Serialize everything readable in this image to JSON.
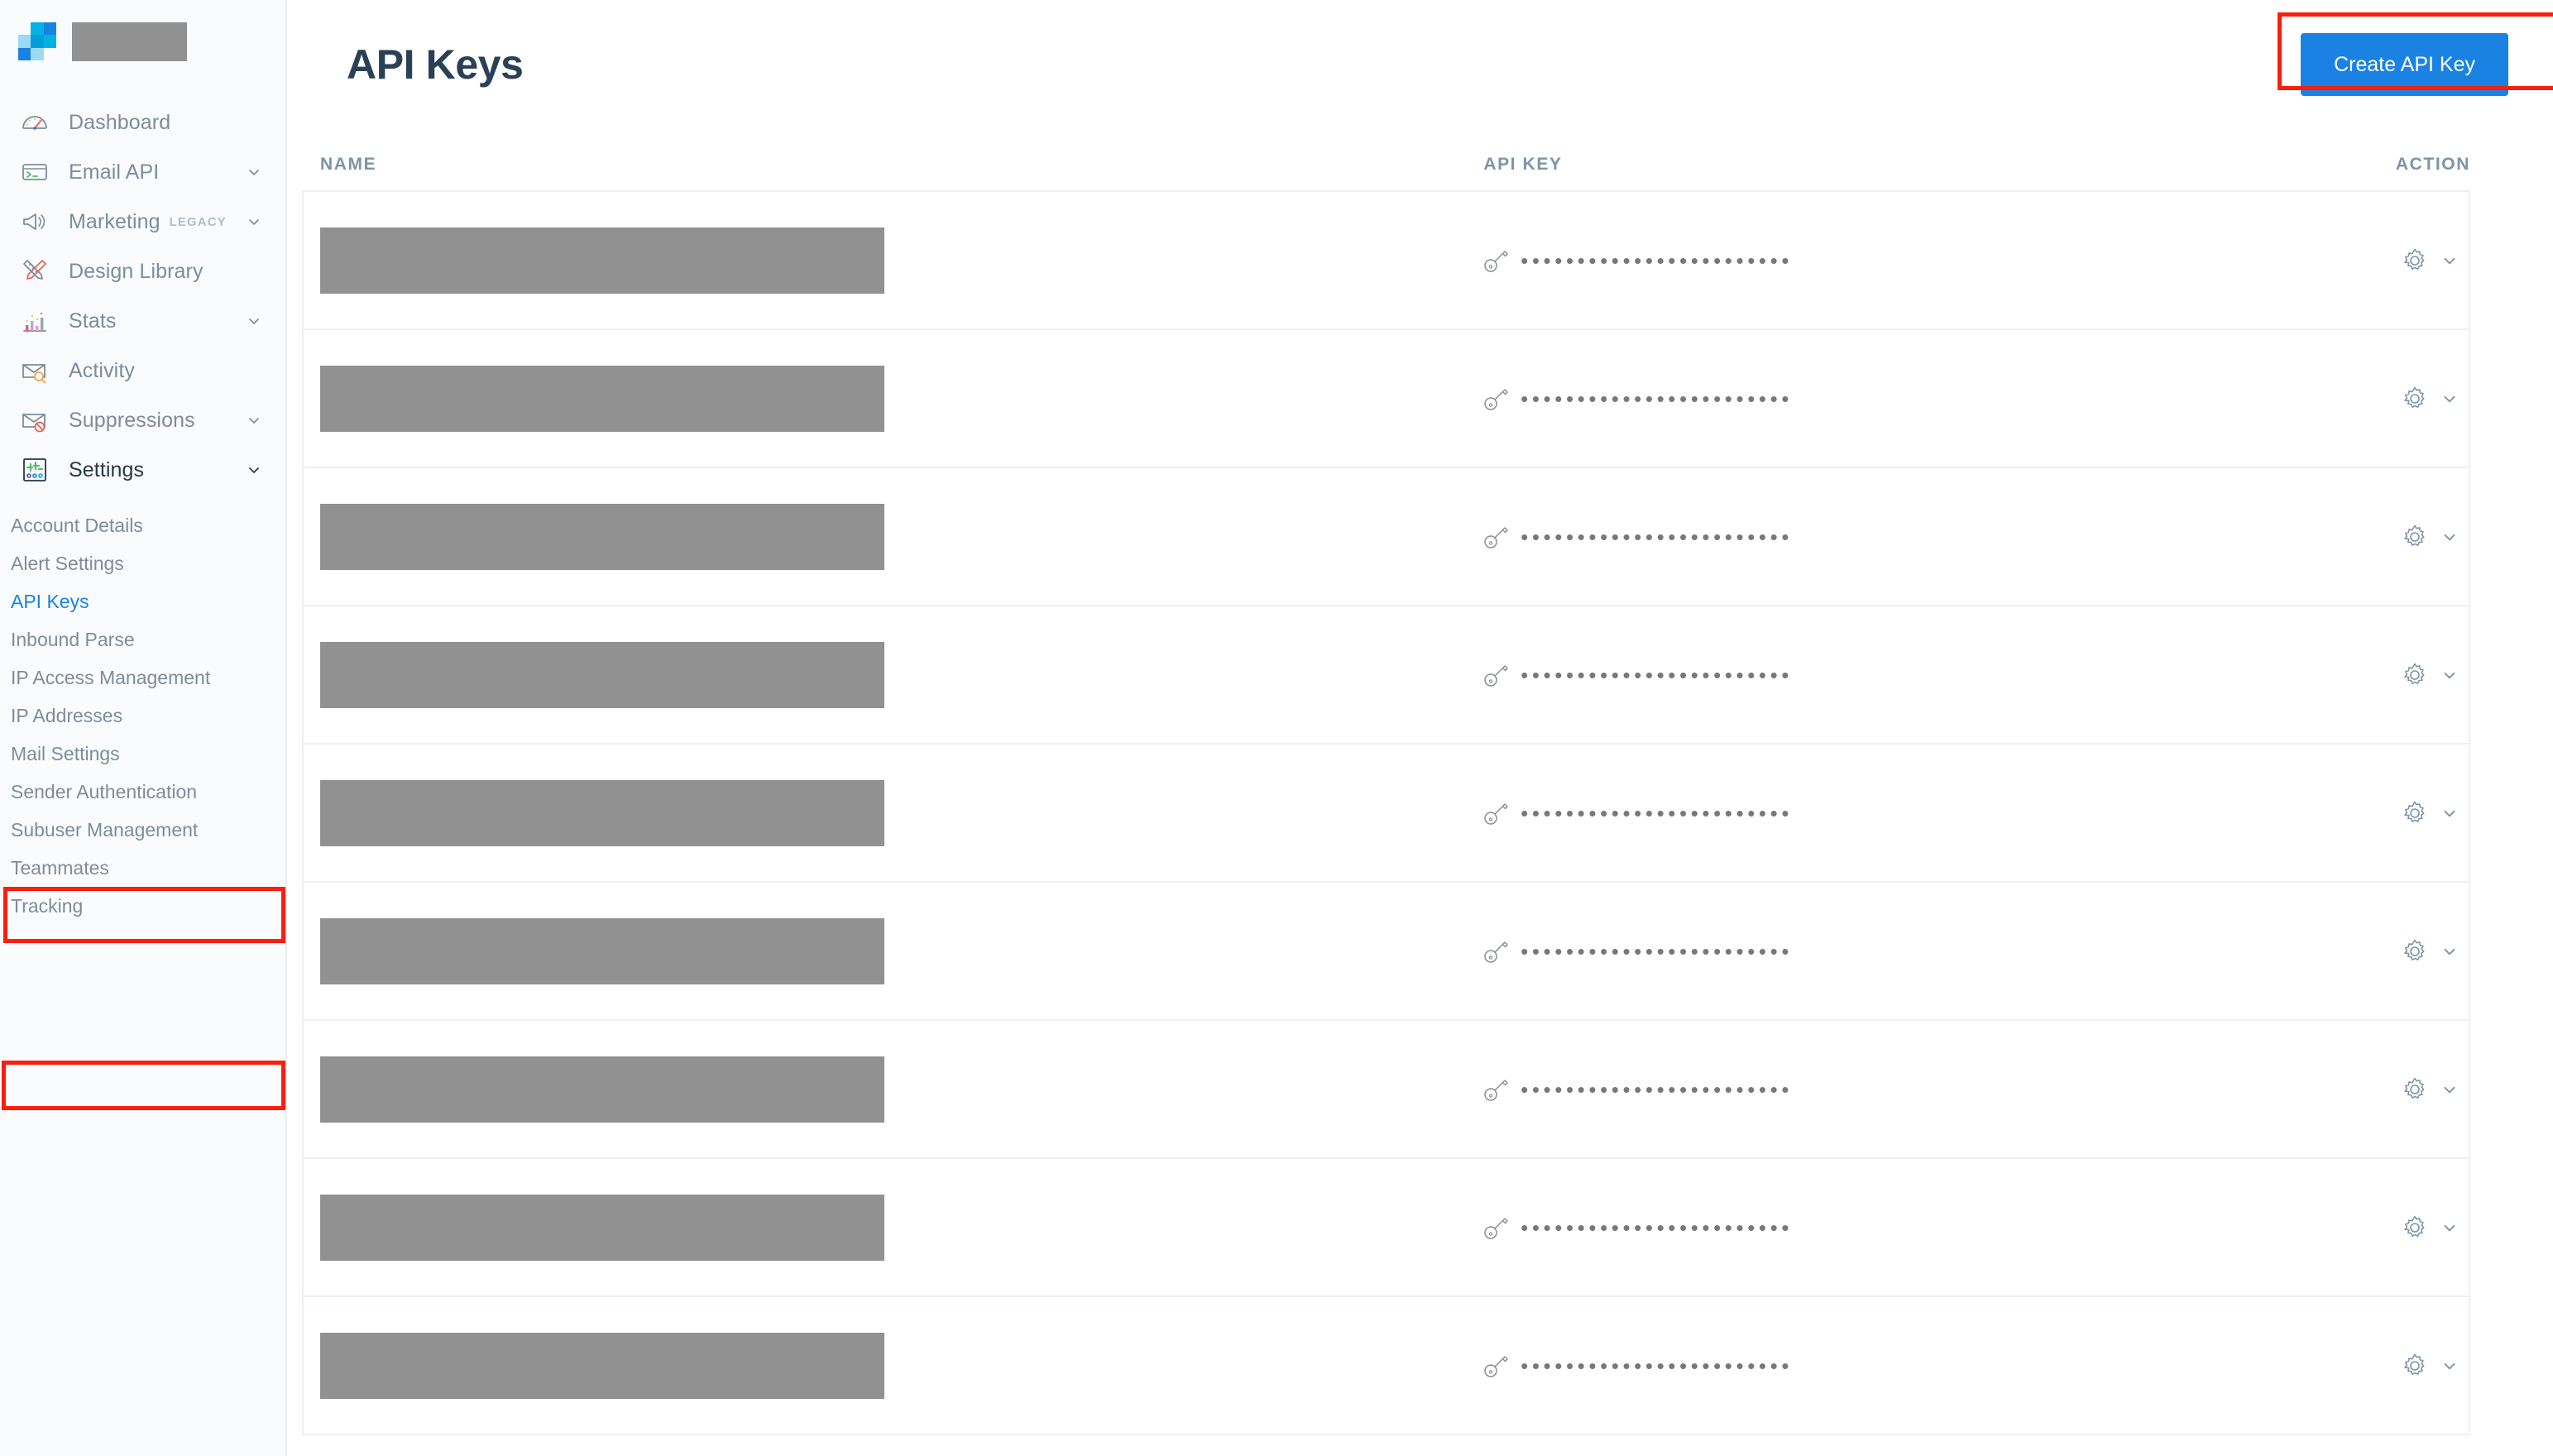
{
  "sidebar": {
    "brand": {
      "logo_icon": "sendgrid-squares-logo",
      "account_name_redacted": true
    },
    "items": [
      {
        "label": "Dashboard",
        "icon": "gauge-icon",
        "expandable": false,
        "active": false
      },
      {
        "label": "Email API",
        "icon": "terminal-icon",
        "expandable": true,
        "active": false
      },
      {
        "label": "Marketing",
        "icon": "megaphone-icon",
        "expandable": true,
        "active": false,
        "badge": "LEGACY"
      },
      {
        "label": "Design Library",
        "icon": "pencil-ruler-icon",
        "expandable": false,
        "active": false
      },
      {
        "label": "Stats",
        "icon": "bar-chart-icon",
        "expandable": true,
        "active": false
      },
      {
        "label": "Activity",
        "icon": "envelope-search-icon",
        "expandable": false,
        "active": false
      },
      {
        "label": "Suppressions",
        "icon": "envelope-block-icon",
        "expandable": true,
        "active": false
      },
      {
        "label": "Settings",
        "icon": "sliders-icon",
        "expandable": true,
        "active": true
      }
    ],
    "submenu": [
      {
        "label": "Account Details",
        "selected": false
      },
      {
        "label": "Alert Settings",
        "selected": false
      },
      {
        "label": "API Keys",
        "selected": true
      },
      {
        "label": "Inbound Parse",
        "selected": false
      },
      {
        "label": "IP Access Management",
        "selected": false
      },
      {
        "label": "IP Addresses",
        "selected": false
      },
      {
        "label": "Mail Settings",
        "selected": false
      },
      {
        "label": "Sender Authentication",
        "selected": false
      },
      {
        "label": "Subuser Management",
        "selected": false
      },
      {
        "label": "Teammates",
        "selected": false
      },
      {
        "label": "Tracking",
        "selected": false
      }
    ]
  },
  "header": {
    "title": "API Keys",
    "create_button_label": "Create API Key"
  },
  "table": {
    "columns": [
      "NAME",
      "API KEY",
      "ACTION"
    ],
    "rows": [
      {
        "name_redacted": true,
        "api_key_masked": "••••••••••••••••••••••••",
        "key_icon": "key-icon",
        "action_icon": "gear-icon",
        "action_chevron": "chevron-down-icon"
      },
      {
        "name_redacted": true,
        "api_key_masked": "••••••••••••••••••••••••",
        "key_icon": "key-icon",
        "action_icon": "gear-icon",
        "action_chevron": "chevron-down-icon"
      },
      {
        "name_redacted": true,
        "api_key_masked": "••••••••••••••••••••••••",
        "key_icon": "key-icon",
        "action_icon": "gear-icon",
        "action_chevron": "chevron-down-icon"
      },
      {
        "name_redacted": true,
        "api_key_masked": "••••••••••••••••••••••••",
        "key_icon": "key-icon",
        "action_icon": "gear-icon",
        "action_chevron": "chevron-down-icon"
      },
      {
        "name_redacted": true,
        "api_key_masked": "••••••••••••••••••••••••",
        "key_icon": "key-icon",
        "action_icon": "gear-icon",
        "action_chevron": "chevron-down-icon"
      },
      {
        "name_redacted": true,
        "api_key_masked": "••••••••••••••••••••••••",
        "key_icon": "key-icon",
        "action_icon": "gear-icon",
        "action_chevron": "chevron-down-icon"
      },
      {
        "name_redacted": true,
        "api_key_masked": "••••••••••••••••••••••••",
        "key_icon": "key-icon",
        "action_icon": "gear-icon",
        "action_chevron": "chevron-down-icon"
      },
      {
        "name_redacted": true,
        "api_key_masked": "••••••••••••••••••••••••",
        "key_icon": "key-icon",
        "action_icon": "gear-icon",
        "action_chevron": "chevron-down-icon"
      },
      {
        "name_redacted": true,
        "api_key_masked": "••••••••••••••••••••••••",
        "key_icon": "key-icon",
        "action_icon": "gear-icon",
        "action_chevron": "chevron-down-icon"
      }
    ]
  },
  "colors": {
    "accent_blue": "#1a82e2",
    "highlight_red": "#fa1e0e",
    "title_navy": "#2a4155",
    "muted_text": "#7f8c9b",
    "header_text": "#7e93a7",
    "redaction_gray": "#919191",
    "sidebar_bg": "#fafbfc",
    "row_border": "#edf1f4"
  },
  "annotations": {
    "highlighted_elements": [
      "Create API Key",
      "Settings",
      "API Keys"
    ]
  }
}
